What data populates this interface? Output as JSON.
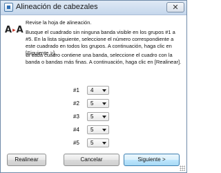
{
  "window": {
    "title": "Alineación de cabezales",
    "close_glyph": "✕"
  },
  "logo": {
    "left": "A",
    "arrow": "▸",
    "right": "A"
  },
  "instructions": {
    "line1": "Revise la hoja de alineación.",
    "para2": "Busque el cuadrado sin ninguna banda visible en los grupos #1 a #5. En la lista siguiente, seleccione el número correspondiente a este cuadrado en todos los grupos. A continuación, haga clic en [Siguiente >].",
    "para3": "Si cada cuadro contiene una banda, seleccione el cuadro con la banda o bandas más finas. A continuación, haga clic en [Realinear]."
  },
  "groups": [
    {
      "label": "#1",
      "value": "4"
    },
    {
      "label": "#2",
      "value": "5"
    },
    {
      "label": "#3",
      "value": "5"
    },
    {
      "label": "#4",
      "value": "5"
    },
    {
      "label": "#5",
      "value": "5"
    }
  ],
  "buttons": {
    "realign": "Realinear",
    "cancel": "Cancelar",
    "next": "Siguiente >"
  }
}
